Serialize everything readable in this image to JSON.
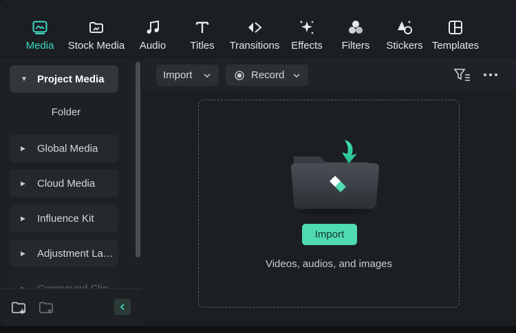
{
  "toolbar": {
    "tabs": [
      {
        "label": "Media",
        "icon": "media-icon",
        "active": true
      },
      {
        "label": "Stock Media",
        "icon": "stock-media-icon"
      },
      {
        "label": "Audio",
        "icon": "music-note-icon"
      },
      {
        "label": "Titles",
        "icon": "title-t-icon"
      },
      {
        "label": "Transitions",
        "icon": "transition-arrows-icon"
      },
      {
        "label": "Effects",
        "icon": "sparkle-icon"
      },
      {
        "label": "Filters",
        "icon": "filter-circles-icon"
      },
      {
        "label": "Stickers",
        "icon": "sticker-icon"
      },
      {
        "label": "Templates",
        "icon": "template-grid-icon"
      }
    ]
  },
  "sidebar": {
    "project_media": "Project Media",
    "folder": "Folder",
    "items": [
      "Global Media",
      "Cloud Media",
      "Influence Kit",
      "Adjustment Layer",
      "Compound Clip"
    ]
  },
  "main": {
    "import_dropdown": "Import",
    "record_dropdown": "Record",
    "import_button": "Import",
    "hint": "Videos, audios, and images"
  },
  "colors": {
    "accent": "#3fd8c2",
    "import_green": "#4fdbb1",
    "background": "#1d2024"
  }
}
